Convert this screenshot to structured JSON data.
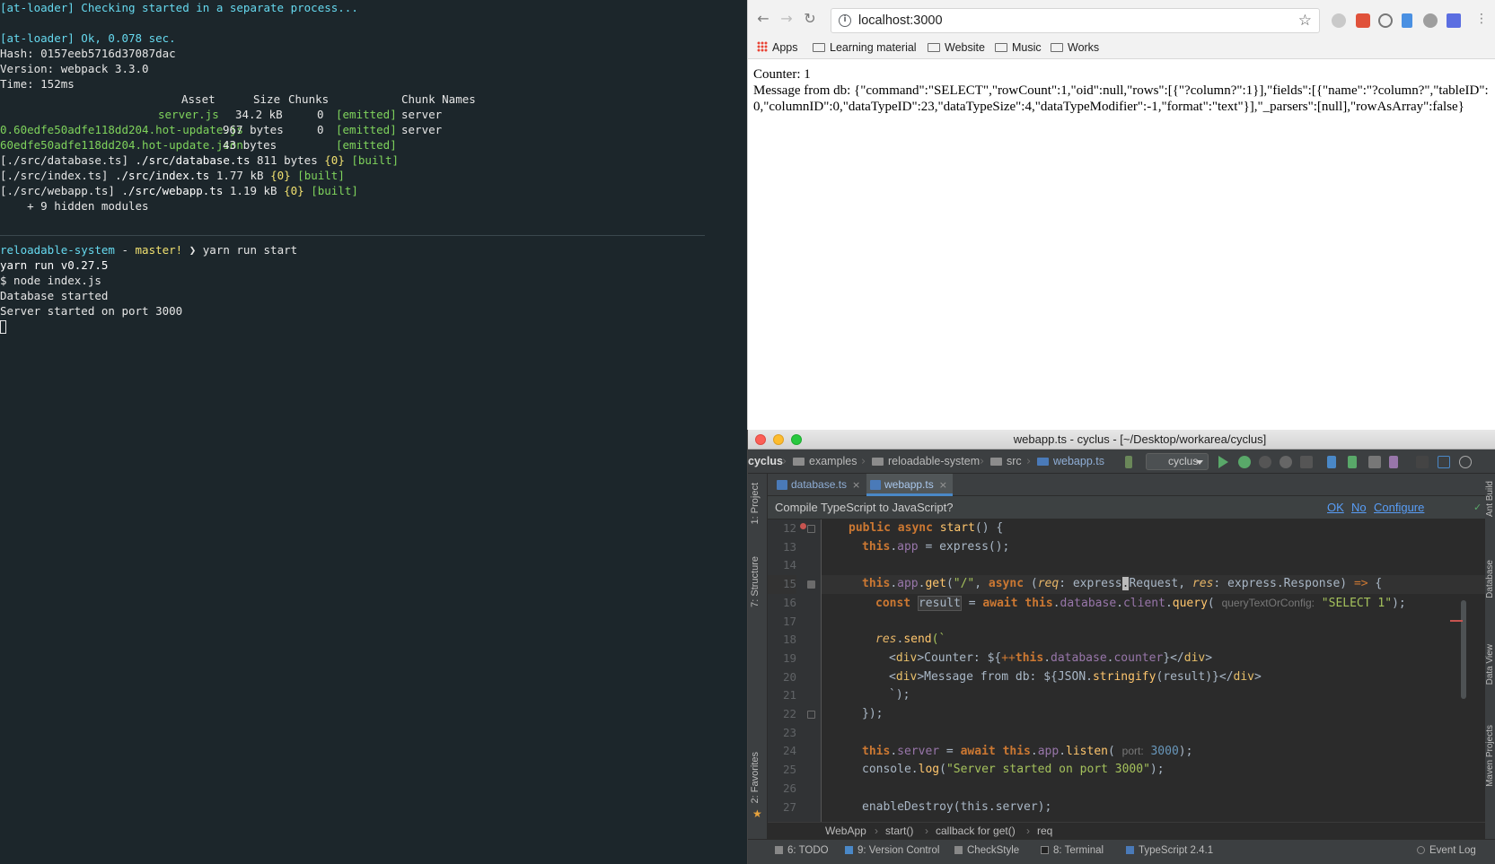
{
  "terminal": {
    "top_lines": [
      "[at-loader] Checking started in a separate process...",
      "",
      "[at-loader] Ok, 0.078 sec.",
      "Hash: 0157eeb5716d37087dac",
      "Version: webpack 3.3.0",
      "Time: 152ms"
    ],
    "build_header": {
      "asset": "Asset",
      "size": "Size",
      "chunks": "Chunks",
      "chunk_names": "Chunk Names"
    },
    "build_rows": [
      {
        "asset": "server.js",
        "size": "34.2 kB",
        "chunks": "0",
        "emitted": "[emitted]",
        "name": "server"
      },
      {
        "asset": "0.60edfe50adfe118dd204.hot-update.js",
        "size": "967 bytes",
        "chunks": "0",
        "emitted": "[emitted]",
        "name": "server"
      },
      {
        "asset": "60edfe50adfe118dd204.hot-update.json",
        "size": "43 bytes",
        "chunks": "",
        "emitted": "[emitted]",
        "name": ""
      }
    ],
    "module_lines": [
      {
        "src": "[./src/database.ts]",
        "path": "./src/database.ts",
        "size": "811 bytes",
        "chunk": "{0}",
        "built": "[built]"
      },
      {
        "src": "[./src/index.ts]",
        "path": "./src/index.ts",
        "size": "1.77 kB",
        "chunk": "{0}",
        "built": "[built]"
      },
      {
        "src": "[./src/webapp.ts]",
        "path": "./src/webapp.ts",
        "size": "1.19 kB",
        "chunk": "{0}",
        "built": "[built]"
      }
    ],
    "hidden_modules": "    + 9 hidden modules",
    "prompt": {
      "dir": "reloadable-system",
      "sep": " - ",
      "branch": "master!",
      "arrow": " ❯ ",
      "command": "yarn run start"
    },
    "bottom_lines": [
      "yarn run v0.27.5",
      "$ node index.js",
      "Database started",
      "Server started on port 3000"
    ]
  },
  "browser": {
    "url": "localhost:3000",
    "bookmarks": [
      "Apps",
      "Learning material",
      "Website",
      "Music",
      "Works"
    ],
    "page": {
      "counter": "Counter: 1",
      "message": "Message from db: {\"command\":\"SELECT\",\"rowCount\":1,\"oid\":null,\"rows\":[{\"?column?\":1}],\"fields\":[{\"name\":\"?column?\",\"tableID\":0,\"columnID\":0,\"dataTypeID\":23,\"dataTypeSize\":4,\"dataTypeModifier\":-1,\"format\":\"text\"}],\"_parsers\":[null],\"rowAsArray\":false}"
    }
  },
  "ide": {
    "window_title": "webapp.ts - cyclus - [~/Desktop/workarea/cyclus]",
    "nav_crumbs": [
      "cyclus",
      "examples",
      "reloadable-system",
      "src",
      "webapp.ts"
    ],
    "run_config": "cyclus",
    "tabs": [
      {
        "label": "database.ts",
        "close": "×"
      },
      {
        "label": "webapp.ts",
        "close": "×"
      }
    ],
    "side_tabs_left": [
      "1: Project",
      "7: Structure",
      "2: Favorites"
    ],
    "side_tabs_right": [
      "Ant Build",
      "Database",
      "Data View",
      "Maven Projects"
    ],
    "banner": {
      "text": "Compile TypeScript to JavaScript?",
      "ok": "OK",
      "no": "No",
      "configure": "Configure"
    },
    "line_numbers": [
      "12",
      "13",
      "14",
      "15",
      "16",
      "17",
      "18",
      "19",
      "20",
      "21",
      "22",
      "23",
      "24",
      "25",
      "26",
      "27"
    ],
    "code": {
      "l12": {
        "a": "public ",
        "b": "async ",
        "c": "start",
        "d": "() {"
      },
      "l13": {
        "a": "this",
        "b": ".",
        "c": "app",
        "d": " = express();"
      },
      "l15": {
        "a": "this",
        "b": ".",
        "c": "app",
        "d": ".",
        "e": "get",
        "f": "(",
        "g": "\"/\"",
        "h": ", ",
        "i": "async",
        "j": " (",
        "k": "req",
        "l": ": express",
        "m": ".",
        "n": "Request, ",
        "o": "res",
        "p": ": express.Response) ",
        "q": "=>",
        "r": " {"
      },
      "l16": {
        "a": "const ",
        "b": "result",
        "c": " = ",
        "d": "await ",
        "e": "this",
        "f": ".",
        "g": "database",
        "h": ".",
        "i": "client",
        "j": ".",
        "k": "query",
        "l": "( ",
        "m": "queryTextOrConfig:",
        "n": " ",
        "o": "\"SELECT 1\"",
        "p": ");"
      },
      "l18": {
        "a": "res",
        "b": ".",
        "c": "send",
        "d": "(`"
      },
      "l19": {
        "a": "<",
        "b": "div",
        "c": ">Counter: ${",
        "d": "++",
        "e": "this",
        "f": ".",
        "g": "database",
        "h": ".",
        "i": "counter",
        "j": "}</",
        "k": "div",
        "l": ">"
      },
      "l20": {
        "a": "<",
        "b": "div",
        "c": ">Message from db: ${JSON.",
        "d": "stringify",
        "e": "(result)}</",
        "f": "div",
        "g": ">"
      },
      "l21": {
        "a": "`);"
      },
      "l22": {
        "a": "});"
      },
      "l24": {
        "a": "this",
        "b": ".",
        "c": "server",
        "d": " = ",
        "e": "await ",
        "f": "this",
        "g": ".",
        "h": "app",
        "i": ".",
        "j": "listen",
        "k": "( ",
        "l": "port:",
        "m": " ",
        "n": "3000",
        "o": ");"
      },
      "l25": {
        "a": "console",
        "b": ".",
        "c": "log",
        "d": "(",
        "e": "\"Server started on port 3000\"",
        "f": ");"
      },
      "l27": {
        "a": "enableDestroy(this.server);"
      }
    },
    "editor_crumbs": [
      "WebApp",
      "start()",
      "callback for get()",
      "req"
    ],
    "status_items": [
      "6: TODO",
      "9: Version Control",
      "CheckStyle",
      "8: Terminal",
      "TypeScript 2.4.1",
      "Event Log"
    ]
  }
}
